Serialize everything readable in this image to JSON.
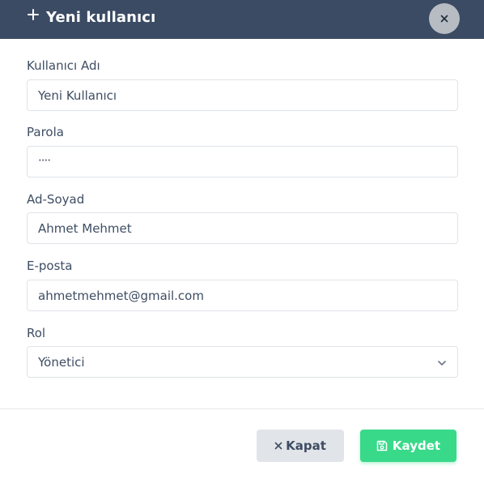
{
  "modal": {
    "title": "Yeni kullanıcı",
    "close_icon": "close-icon",
    "plus_icon": "plus-icon",
    "header_bg": "#3b4b63"
  },
  "form": {
    "fields": [
      {
        "label": "Kullanıcı Adı",
        "value": "Yeni Kullanıcı"
      },
      {
        "label": "Parola",
        "value": "····"
      },
      {
        "label": "Ad-Soyad",
        "value": "Ahmet Mehmet"
      },
      {
        "label": "E-posta",
        "value": "ahmetmehmet@gmail.com"
      },
      {
        "label": "Rol",
        "value": "Yönetici"
      }
    ]
  },
  "footer": {
    "close_label": "Kapat",
    "save_label": "Kaydet",
    "save_color": "#39d98a"
  }
}
